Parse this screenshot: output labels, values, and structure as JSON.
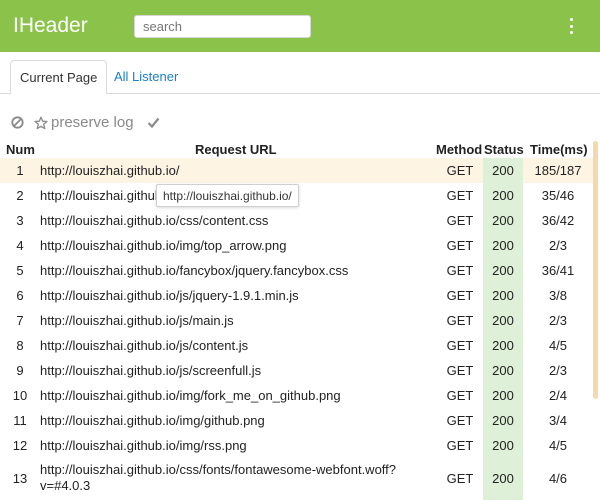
{
  "header": {
    "title": "IHeader",
    "search_placeholder": "search",
    "menu_icon": "kebab-menu-icon",
    "background_color": "#8bc34a"
  },
  "tabs": [
    {
      "label": "Current Page",
      "active": true
    },
    {
      "label": "All Listener",
      "active": false
    }
  ],
  "toolbar": {
    "block_icon": "block-icon",
    "preserve_icon": "star-icon",
    "preserve_label": "preserve log",
    "check_icon": "check-icon"
  },
  "table": {
    "headers": {
      "num": "Num",
      "url": "Request URL",
      "method": "Method",
      "status": "Status",
      "time": "Time(ms)"
    },
    "rows": [
      {
        "num": "1",
        "url": "http://louiszhai.github.io/",
        "method": "GET",
        "status": "200",
        "time": "185/187",
        "highlighted": true
      },
      {
        "num": "2",
        "url": "http://louiszhai.github.io/",
        "method": "GET",
        "status": "200",
        "time": "35/46"
      },
      {
        "num": "3",
        "url": "http://louiszhai.github.io/css/content.css",
        "method": "GET",
        "status": "200",
        "time": "36/42"
      },
      {
        "num": "4",
        "url": "http://louiszhai.github.io/img/top_arrow.png",
        "method": "GET",
        "status": "200",
        "time": "2/3"
      },
      {
        "num": "5",
        "url": "http://louiszhai.github.io/fancybox/jquery.fancybox.css",
        "method": "GET",
        "status": "200",
        "time": "36/41"
      },
      {
        "num": "6",
        "url": "http://louiszhai.github.io/js/jquery-1.9.1.min.js",
        "method": "GET",
        "status": "200",
        "time": "3/8"
      },
      {
        "num": "7",
        "url": "http://louiszhai.github.io/js/main.js",
        "method": "GET",
        "status": "200",
        "time": "2/3"
      },
      {
        "num": "8",
        "url": "http://louiszhai.github.io/js/content.js",
        "method": "GET",
        "status": "200",
        "time": "4/5"
      },
      {
        "num": "9",
        "url": "http://louiszhai.github.io/js/screenfull.js",
        "method": "GET",
        "status": "200",
        "time": "2/3"
      },
      {
        "num": "10",
        "url": "http://louiszhai.github.io/img/fork_me_on_github.png",
        "method": "GET",
        "status": "200",
        "time": "2/4"
      },
      {
        "num": "11",
        "url": "http://louiszhai.github.io/img/github.png",
        "method": "GET",
        "status": "200",
        "time": "3/4"
      },
      {
        "num": "12",
        "url": "http://louiszhai.github.io/img/rss.png",
        "method": "GET",
        "status": "200",
        "time": "4/5"
      },
      {
        "num": "13",
        "url": "http://louiszhai.github.io/css/fonts/fontawesome-webfont.woff?v=#4.0.3",
        "method": "GET",
        "status": "200",
        "time": "4/6"
      }
    ],
    "status_color": "#dff0d8",
    "highlight_color": "#fdf4e3"
  },
  "tooltip": {
    "text": "http://louiszhai.github.io/"
  }
}
